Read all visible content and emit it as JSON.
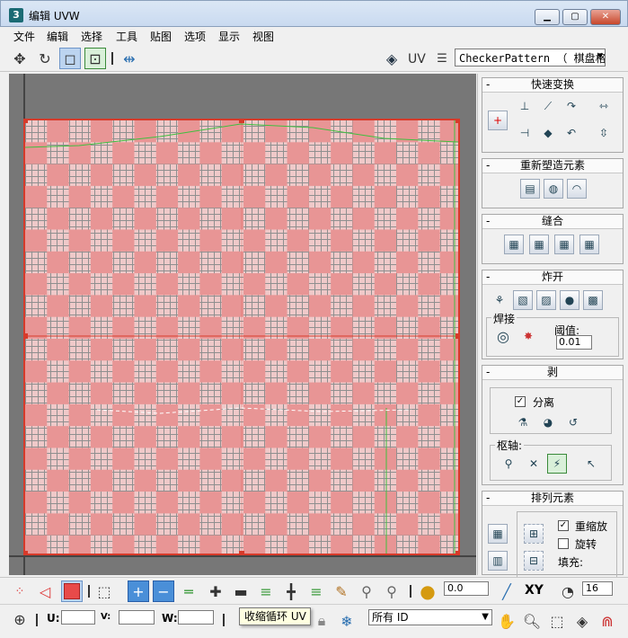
{
  "window": {
    "title": "编辑 UVW"
  },
  "menu": [
    "文件",
    "编辑",
    "选择",
    "工具",
    "贴图",
    "选项",
    "显示",
    "视图"
  ],
  "toolbar": {
    "uv_label": "UV",
    "map_select": "CheckerPattern （ 棋盘格 ）"
  },
  "panel": {
    "quick_transform": {
      "title": "快速变换"
    },
    "reshape": {
      "title": "重新塑造元素"
    },
    "stitch": {
      "title": "缝合"
    },
    "explode": {
      "title": "炸开",
      "weld_label": "焊接",
      "threshold_label": "阈值:",
      "threshold_value": "0.01"
    },
    "peel": {
      "title": "剥",
      "detach_label": "分离",
      "pivot_label": "枢轴:"
    },
    "arrange": {
      "title": "排列元素",
      "rescale_label": "重缩放",
      "rotate_label": "旋转",
      "padding_label": "填充:"
    }
  },
  "bottom": {
    "value_field": "0.0",
    "xy_label": "XY",
    "grid_value": "16",
    "u_label": "U:",
    "v_label": "V:",
    "w_label": "W:",
    "id_select": "所有 ID",
    "tooltip": "收缩循环 UV"
  },
  "colors": {
    "uv_border": "#d73a2a",
    "checker_dark": "#e89595",
    "checker_light": "#efc9c9",
    "viewport_bg": "#777777"
  }
}
